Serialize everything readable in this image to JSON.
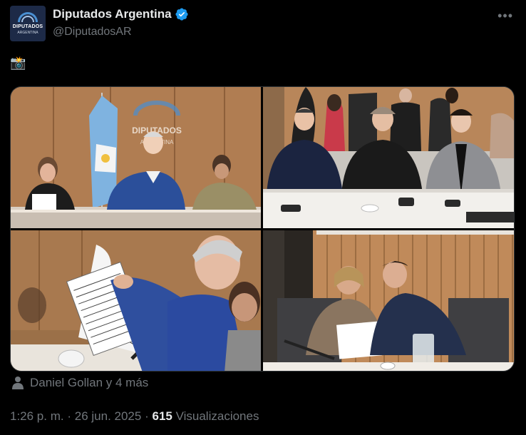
{
  "account": {
    "display_name": "Diputados Argentina",
    "handle": "@DiputadosAR",
    "avatar_line1": "DIPUTADOS",
    "avatar_line2": "ARGENTINA",
    "verified": true
  },
  "tweet": {
    "text": "📸"
  },
  "media": {
    "photos": [
      {
        "name": "photo-1",
        "watermark_line1": "DIPUTADOS",
        "watermark_line2": "ARGENTINA"
      },
      {
        "name": "photo-2"
      },
      {
        "name": "photo-3"
      },
      {
        "name": "photo-4"
      }
    ]
  },
  "tagged": {
    "text": "Daniel Gollan y 4 más"
  },
  "meta": {
    "time": "1:26 p. m.",
    "separator": "·",
    "date": "26 jun. 2025",
    "views_count": "615",
    "views_label": "Visualizaciones"
  },
  "colors": {
    "background": "#000000",
    "primary_text": "#e7e9ea",
    "secondary_text": "#71767b",
    "verified_badge": "#1d9bf0"
  },
  "icons": {
    "more": "more-icon",
    "verified": "verified-badge-icon",
    "tag": "person-tag-icon"
  }
}
